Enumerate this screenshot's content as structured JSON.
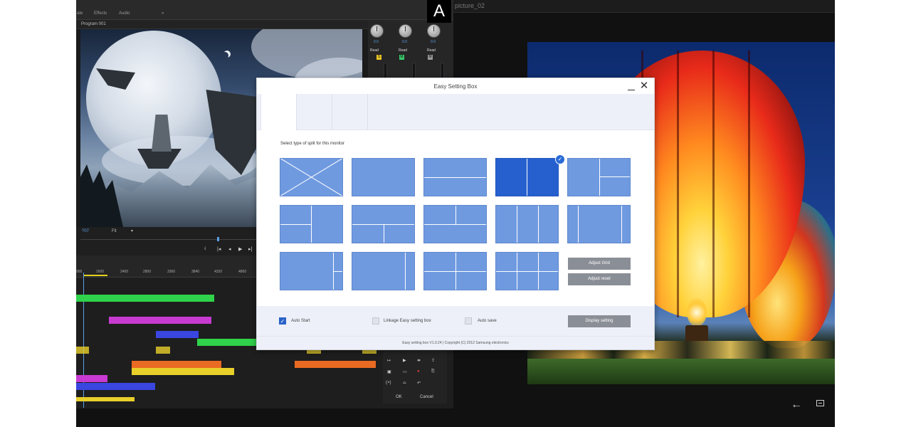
{
  "overlay_label": "A",
  "editor": {
    "tabs": [
      "Effects",
      "Audio"
    ],
    "program_label": "Program 001",
    "timecode": "?07",
    "fit_label": "Fit",
    "fit_dropdown": "▾",
    "ruler_ticks": [
      "1600",
      "2400",
      "2800",
      "3360",
      "3840",
      "4320",
      "4800"
    ],
    "mixer_values": [
      "0.0",
      "0.0",
      "0.0"
    ],
    "mixer_read": [
      "Read",
      "Read",
      "Read"
    ],
    "tools": {
      "ok": "OK",
      "cancel": "Cancel"
    }
  },
  "right_pane": {
    "title": "picture_02"
  },
  "dialog": {
    "title": "Easy Setting Box",
    "instruction": "Select type of split for this monitor",
    "selected_layout_index": 3,
    "buttons": {
      "adjust_grid": "Adjust Grid",
      "adjust_reset": "Adjust reset",
      "display_setting": "Display setting"
    },
    "checkboxes": {
      "auto_start": {
        "label": "Auto Start",
        "checked": true
      },
      "linkage": {
        "label": "Linkage Easy setting box",
        "checked": false
      },
      "auto_save": {
        "label": "Auto save",
        "checked": false
      }
    },
    "version_text": "Easy setting box V1.0.24 | Copyright (C) 2012 Samsung electronics"
  },
  "colors": {
    "tile": "#6f9ae0",
    "tile_selected": "#2660cf",
    "checkbox_checked": "#2a62c9",
    "gray_button": "#8a8e96",
    "clip_green": "#2fd24a",
    "clip_magenta": "#c83ad2",
    "clip_blue": "#3a46e0",
    "clip_yellow": "#e8cf2a",
    "clip_orange": "#e96a22"
  }
}
